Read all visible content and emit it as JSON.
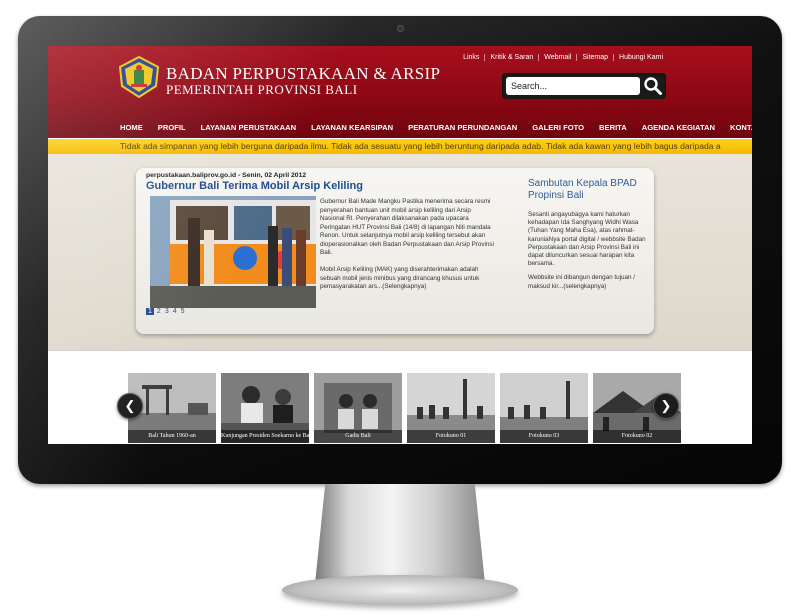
{
  "header": {
    "title_line1": "BADAN PERPUSTAKAAN & ARSIP",
    "title_line2": "PEMERINTAH PROVINSI BALI",
    "top_links": [
      "Links",
      "Kritik & Saran",
      "Webmail",
      "Sitemap",
      "Hubungi Kami"
    ],
    "search_placeholder": "Search..."
  },
  "nav": {
    "items": [
      "HOME",
      "PROFIL",
      "LAYANAN PERUSTAKAAN",
      "LAYANAN KEARSIPAN",
      "PERATURAN PERUNDANGAN",
      "GALERI FOTO",
      "BERITA",
      "AGENDA KEGIATAN",
      "KONTAK KAMI"
    ]
  },
  "ticker": {
    "text": "Tidak ada simpanan yang lebih berguna daripada ilmu. Tidak ada sesuatu yang lebih beruntung daripada adab. Tidak ada kawan yang lebih bagus daripada a"
  },
  "feature": {
    "source_date": "perpustakaan.baliprov.go.id - Senin, 02 April 2012",
    "headline": "Gubernur Bali Terima Mobil Arsip Keliling",
    "paragraph1": "Gubernur Bali Made Mangku Pastika menerima secara resmi penyerahan bantuan unit mobil arsip keliling dari Arsip Nasional RI. Penyerahan dilaksanakan pada upacara Peringatan HUT Provinsi Bali (14/8) di lapangan Niti mandala Renon. Untuk selanjutnya mobil arsip keliling tersebut akan dioperasionalkan oleh Badan Perpustakaan dan Arsip Provinsi Bali.",
    "paragraph2": "Mobil Arsip Keliling (MAK) yang diserahterimakan adalah sebuah mobil jenis minibus yang dirancang khusus untuk pemasyarakatan ars...(Selengkapnya)",
    "pages": [
      "1",
      "2",
      "3",
      "4",
      "5"
    ]
  },
  "sidebar": {
    "heading": "Sambutan Kepala BPAD Propinsi Bali",
    "paragraph1": "Sesanti angayubagya kami haturkan kehadapan Ida Sanghyang Widhi Wasa (Tuhan Yang Maha Esa), atas rahmat-karuniaNya portal digital / webbsite Badan Perpustakaan dan Arsip Provinsi Bali ini dapat diluncurkan sesuai harapan kita bersama.",
    "paragraph2": "Webbsite ini dibangun dengan tujuan / maksud kir...(selengkapnya)"
  },
  "gallery": {
    "captions": [
      "Bali Tahun 1960-an",
      "Kunjungan Presiden Soekarno ke Bali",
      "Gadis Bali",
      "Fotokuno 01",
      "Fotokuno 03",
      "Fotokuno 02"
    ]
  },
  "colors": {
    "header_red": "#8b0714",
    "ticker_yellow": "#ffd21a",
    "link_blue": "#1e4c90"
  }
}
